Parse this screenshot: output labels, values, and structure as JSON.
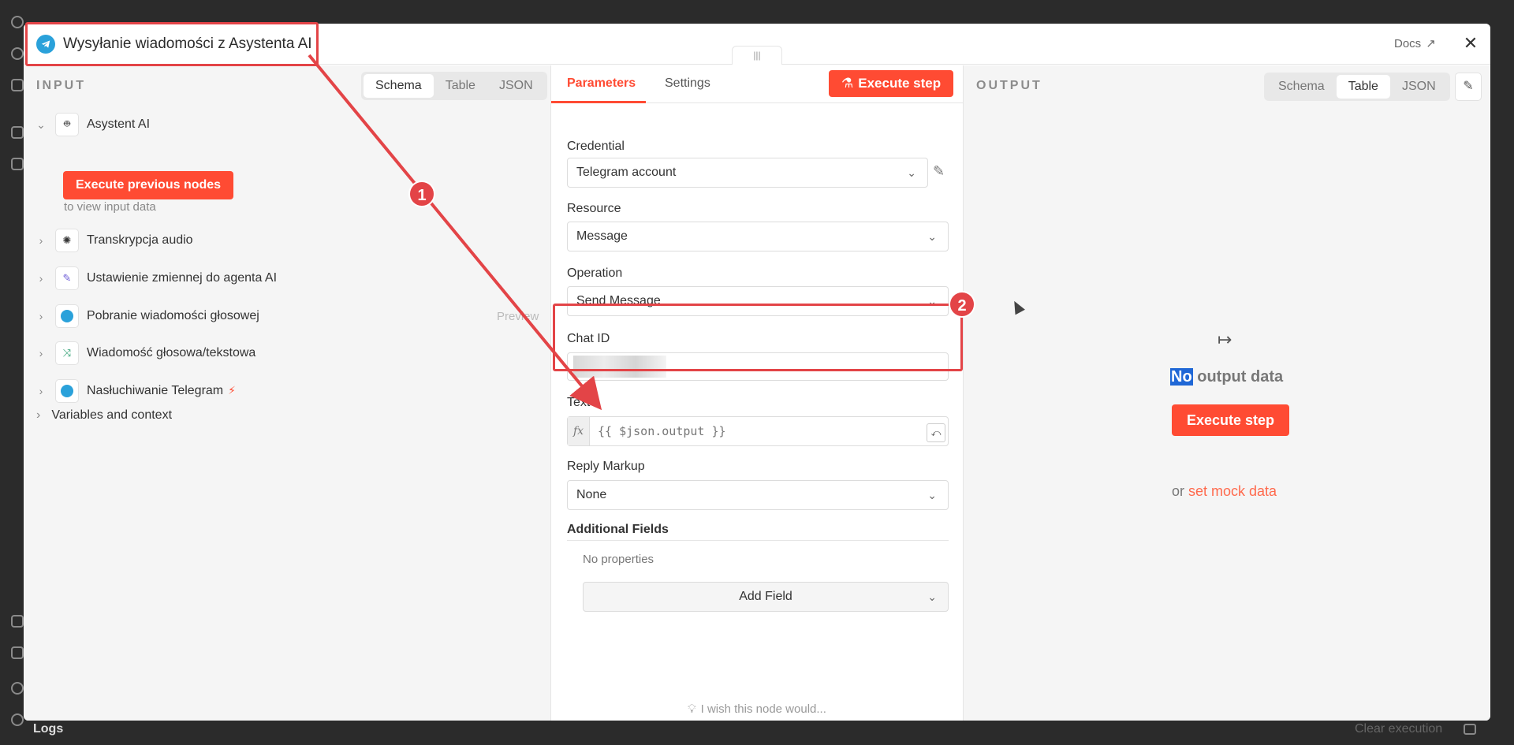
{
  "header": {
    "title": "Wysyłanie wiadomości z Asystenta AI",
    "docs_label": "Docs",
    "close_label": "✕",
    "drag_label": "|||"
  },
  "input": {
    "label": "INPUT",
    "view_tabs": [
      "Schema",
      "Table",
      "JSON"
    ],
    "active_tab": "Schema",
    "execute_previous_label": "Execute previous nodes",
    "view_hint": "to view input data",
    "nodes": [
      {
        "label": "Asystent AI",
        "icon": "robot-icon",
        "expanded": true
      },
      {
        "label": "Transkrypcja audio",
        "icon": "openai-icon"
      },
      {
        "label": "Ustawienie zmiennej do agenta AI",
        "icon": "edit-icon"
      },
      {
        "label": "Pobranie wiadomości głosowej",
        "icon": "telegram-icon",
        "badge": "Preview"
      },
      {
        "label": "Wiadomość głosowa/tekstowa",
        "icon": "switch-icon"
      },
      {
        "label": "Nasłuchiwanie Telegram",
        "icon": "telegram-icon",
        "trigger": true
      }
    ],
    "variables_label": "Variables and context"
  },
  "parameters": {
    "tabs": [
      "Parameters",
      "Settings"
    ],
    "active_tab": "Parameters",
    "execute_label": "Execute step",
    "credential": {
      "label": "Credential",
      "value": "Telegram account"
    },
    "resource": {
      "label": "Resource",
      "value": "Message"
    },
    "operation": {
      "label": "Operation",
      "value": "Send Message"
    },
    "chat_id": {
      "label": "Chat ID",
      "value": ""
    },
    "text": {
      "label": "Text",
      "value": "{{ $json.output }}",
      "fx": "fx"
    },
    "reply_markup": {
      "label": "Reply Markup",
      "value": "None"
    },
    "additional_fields": {
      "label": "Additional Fields",
      "empty": "No properties",
      "add_label": "Add Field"
    },
    "wish": "I wish this node would..."
  },
  "output": {
    "label": "OUTPUT",
    "view_tabs": [
      "Schema",
      "Table",
      "JSON"
    ],
    "active_tab": "Table",
    "no_output_prefix": "No",
    "no_output_rest": " output data",
    "execute_label": "Execute step",
    "or_label": "or ",
    "mock_link": "set mock data"
  },
  "background": {
    "logs_label": "Logs",
    "clear_label": "Clear execution"
  },
  "annotations": {
    "badges": [
      "1",
      "2"
    ],
    "color": "#e34447"
  },
  "colors": {
    "accent": "#ff4b33",
    "telegram": "#2aa1da",
    "selection": "#1f67d6"
  }
}
